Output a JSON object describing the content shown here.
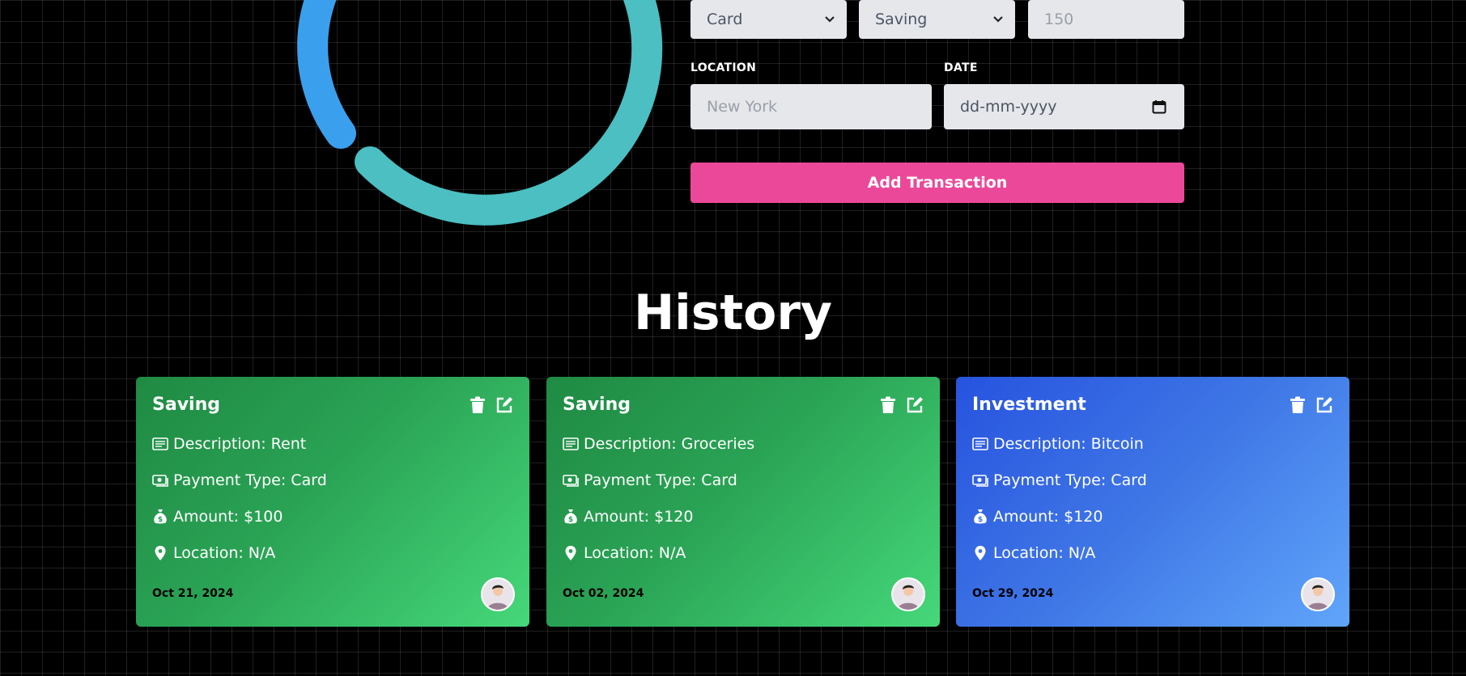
{
  "form": {
    "payment_select_value": "Card",
    "category_select_value": "Saving",
    "amount_placeholder": "150",
    "location_label": "LOCATION",
    "location_placeholder": "New York",
    "date_label": "DATE",
    "date_placeholder": "dd-mm-yyyy",
    "submit_label": "Add Transaction"
  },
  "history": {
    "title": "History",
    "cards": [
      {
        "category": "Saving",
        "description": "Description: Rent",
        "payment": "Payment Type: Card",
        "amount": "Amount: $100",
        "location": "Location: N/A",
        "date": "Oct 21, 2024",
        "theme": "green"
      },
      {
        "category": "Saving",
        "description": "Description: Groceries",
        "payment": "Payment Type: Card",
        "amount": "Amount: $120",
        "location": "Location: N/A",
        "date": "Oct 02, 2024",
        "theme": "green"
      },
      {
        "category": "Investment",
        "description": "Description: Bitcoin",
        "payment": "Payment Type: Card",
        "amount": "Amount: $120",
        "location": "Location: N/A",
        "date": "Oct 29, 2024",
        "theme": "blue"
      }
    ]
  },
  "icons": {
    "delete": "trash-icon",
    "edit": "edit-icon",
    "description": "document-icon",
    "payment": "cash-icon",
    "amount": "money-bag-icon",
    "location": "map-pin-icon",
    "date": "calendar-icon",
    "select": "chevron-down-icon"
  },
  "colors": {
    "accent_button": "#ec4899",
    "donut_blue": "#3aa0ee",
    "donut_teal": "#4bbfc2",
    "card_green": "#2aa355",
    "card_blue": "#3f77e6",
    "field_bg": "#e5e7eb"
  }
}
